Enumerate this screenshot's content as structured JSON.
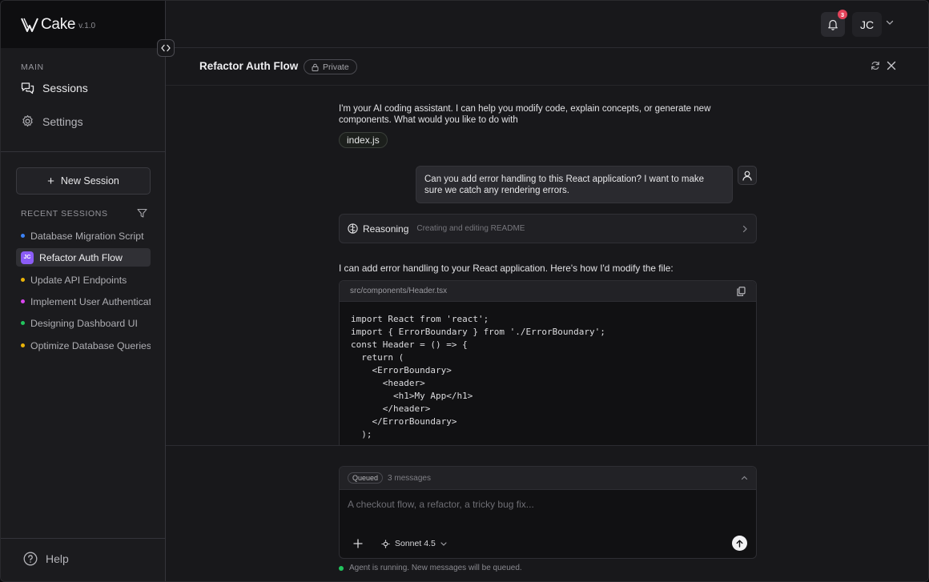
{
  "brand": {
    "name": "Cake",
    "version": "v.1.0"
  },
  "sidebar": {
    "main_label": "MAIN",
    "nav": [
      {
        "label": "Sessions",
        "icon": "chat-bubbles-icon"
      },
      {
        "label": "Settings",
        "icon": "gear-icon"
      }
    ],
    "new_session_label": "New Session",
    "recent_label": "RECENT SESSIONS",
    "sessions": [
      {
        "label": "Database Migration Script",
        "color": "#3b82f6"
      },
      {
        "label": "Refactor Auth Flow",
        "avatar": "JC",
        "active": true
      },
      {
        "label": "Update API Endpoints",
        "color": "#eab308"
      },
      {
        "label": "Implement User Authenticat",
        "color": "#d946ef"
      },
      {
        "label": "Designing Dashboard UI",
        "color": "#22c55e"
      },
      {
        "label": "Optimize Database Queries",
        "color": "#eab308"
      }
    ],
    "help_label": "Help"
  },
  "topbar": {
    "notification_count": "3",
    "user_initials": "JC"
  },
  "content": {
    "title": "Refactor Auth Flow",
    "visibility": "Private"
  },
  "chat": {
    "ai_intro": "I'm your AI coding assistant. I can help you modify code, explain concepts, or generate new components. What would you like to do with",
    "file_chip": "index.js",
    "user_message": "Can you add error handling to this React application? I want to make sure we catch any rendering errors.",
    "reasoning_label": "Reasoning",
    "reasoning_status": "Creating and editing README",
    "ai_reply": "I can add error handling to your React application. Here's how I'd modify the file:",
    "code_file": "src/components/Header.tsx",
    "code_lines": [
      "import React from 'react';",
      "import { ErrorBoundary } from './ErrorBoundary';",
      "",
      "const Header = () => {",
      "  return (",
      "    <ErrorBoundary>",
      "      <header>",
      "        <h1>My App</h1>",
      "      </header>",
      "    </ErrorBoundary>",
      "  );"
    ]
  },
  "composer": {
    "queued_tag": "Queued",
    "queued_count": "3 messages",
    "placeholder": "A checkout flow, a refactor, a tricky bug fix...",
    "model": "Sonnet 4.5",
    "status": "Agent is running. New messages will be queued."
  }
}
